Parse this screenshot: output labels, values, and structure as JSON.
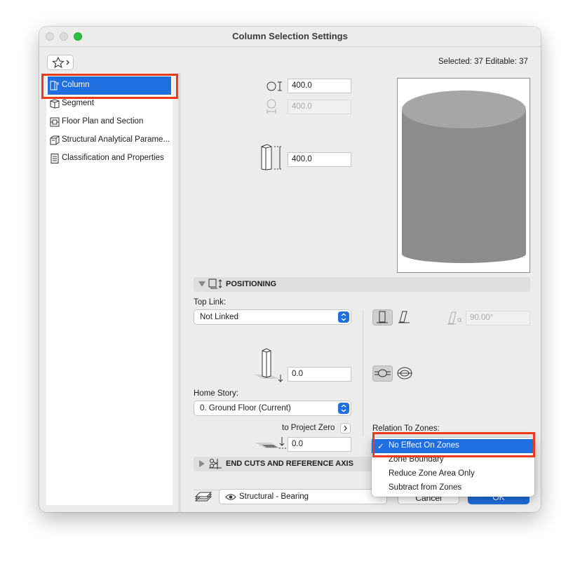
{
  "window": {
    "title": "Column Selection Settings"
  },
  "header": {
    "selection_info": "Selected: 37 Editable: 37"
  },
  "sidebar": {
    "items": [
      {
        "label": "Column",
        "icon": "column-icon",
        "selected": true
      },
      {
        "label": "Segment",
        "icon": "segment-icon"
      },
      {
        "label": "Floor Plan and Section",
        "icon": "floor-plan-icon"
      },
      {
        "label": "Structural Analytical Parame...",
        "icon": "structural-analytical-icon"
      },
      {
        "label": "Classification and Properties",
        "icon": "classification-icon"
      }
    ]
  },
  "geometry": {
    "width_value": "400.0",
    "depth_value": "400.0",
    "height_value": "400.0"
  },
  "positioning": {
    "section_title": "POSITIONING",
    "top_link_label": "Top Link:",
    "top_link_value": "Not Linked",
    "angle_value": "90.00°",
    "bottom_offset_value": "0.0",
    "home_story_label": "Home Story:",
    "home_story_value": "0. Ground Floor (Current)",
    "to_project_zero_label": "to Project Zero",
    "project_zero_value": "0.0",
    "relation_label": "Relation To Zones:"
  },
  "zone_menu": {
    "items": [
      {
        "label": "No Effect On Zones",
        "selected": true,
        "check": "✓"
      },
      {
        "label": "Zone Boundary"
      },
      {
        "label": "Reduce Zone Area Only"
      },
      {
        "label": "Subtract from Zones"
      }
    ]
  },
  "end_cuts": {
    "section_title": "END CUTS AND REFERENCE AXIS"
  },
  "footer": {
    "layer_value": "Structural - Bearing",
    "cancel_label": "Cancel",
    "ok_label": "OK"
  },
  "colors": {
    "accent": "#1f6fe0",
    "highlight_box": "#f0391a"
  }
}
